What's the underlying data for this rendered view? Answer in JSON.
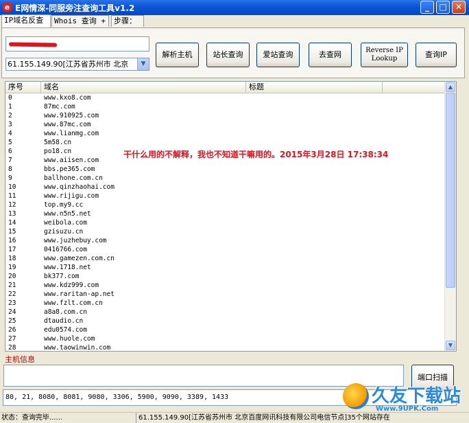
{
  "window": {
    "title": "E网情深-同服旁注查询工具v1.2",
    "app_icon": "e",
    "minimize": "_",
    "maximize": "□",
    "close": "✕"
  },
  "tabs": [
    {
      "label": "IP域名反查",
      "active": true
    },
    {
      "label": "Whois 查询 +",
      "active": false
    },
    {
      "label": "步骤：",
      "active": false
    }
  ],
  "query": {
    "host_value": "",
    "ip_combo": "61.155.149.90[江苏省苏州市 北京"
  },
  "buttons": {
    "resolve_host": "解析主机",
    "webmaster_query": "站长查询",
    "aizhan_query": "爱站查询",
    "go_to_site": "去查网",
    "reverse_ip_line1": "Reverse IP",
    "reverse_ip_line2": "Lookup",
    "query_ip": "查询IP",
    "port_scan": "端口扫描"
  },
  "table": {
    "columns": [
      "序号",
      "域名",
      "标题"
    ],
    "rows": [
      [
        "0",
        "www.kxo8.com"
      ],
      [
        "1",
        "87mc.com"
      ],
      [
        "2",
        "www.910925.com"
      ],
      [
        "3",
        "www.87mc.com"
      ],
      [
        "4",
        "www.lianmg.com"
      ],
      [
        "5",
        "5m58.cn"
      ],
      [
        "6",
        "po18.cn"
      ],
      [
        "7",
        "www.aiisen.com"
      ],
      [
        "8",
        "bbs.pe365.com"
      ],
      [
        "9",
        "ballhone.com.cn"
      ],
      [
        "10",
        "www.qinzhaohai.com"
      ],
      [
        "11",
        "www.rijigu.com"
      ],
      [
        "12",
        "top.my9.cc"
      ],
      [
        "13",
        "www.n5n5.net"
      ],
      [
        "14",
        "weibola.com"
      ],
      [
        "15",
        "gzisuzu.cn"
      ],
      [
        "16",
        "www.juzhebuy.com"
      ],
      [
        "17",
        "0416766.com"
      ],
      [
        "18",
        "www.gamezen.com.cn"
      ],
      [
        "19",
        "www.1718.net"
      ],
      [
        "20",
        "bk377.com"
      ],
      [
        "21",
        "www.kdz999.com"
      ],
      [
        "22",
        "www.raritan-ap.net"
      ],
      [
        "23",
        "www.fzlt.com.cn"
      ],
      [
        "24",
        "a8a8.com.cn"
      ],
      [
        "25",
        "dtaudio.cn"
      ],
      [
        "26",
        "edu0574.com"
      ],
      [
        "27",
        "www.huole.com"
      ],
      [
        "28",
        "www.taowinwin.com"
      ]
    ]
  },
  "annotation": "干什么用的不解释，我也不知道干嘛用的。2015年3月28日 17:38:34",
  "host_info": {
    "label": "主机信息",
    "value": ""
  },
  "ports": "80, 21, 8080, 8081, 9080, 3306, 5900, 9090, 3389, 1433",
  "status": {
    "left": "状态：查询完毕......",
    "right": "61.155.149.90[江苏省苏州市 北京百度网讯科技有限公司电信节点]35个网站存在"
  },
  "watermark": {
    "brand": "久友下载站",
    "url": "Www.9UPK.Com"
  }
}
